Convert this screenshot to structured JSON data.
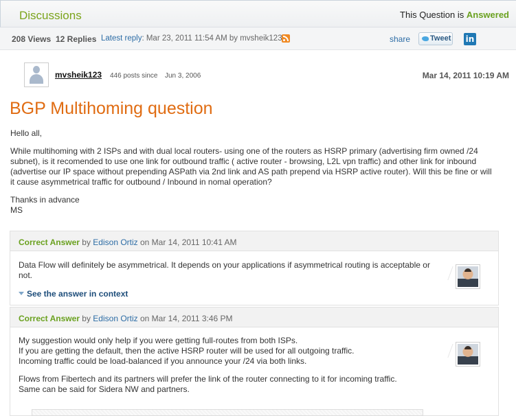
{
  "header": {
    "title": "Discussions",
    "status_prefix": "This Question is",
    "status_value": "Answered"
  },
  "metabar": {
    "views": "208 Views",
    "replies": "12 Replies",
    "latest_label": "Latest reply",
    "latest_info": ": Mar 23, 2011 11:54 AM by mvsheik123",
    "share": "share",
    "tweet": "Tweet",
    "linkedin": "in",
    "icons": [
      "rss-icon",
      "twitter-bird-icon",
      "linkedin-icon"
    ]
  },
  "post": {
    "author": "mvsheik123",
    "posts": "446 posts since",
    "since": "Jun 3, 2006",
    "date": "Mar 14, 2011 10:19 AM",
    "title": "BGP Multihoming question",
    "greeting": "Hello all,",
    "body": "While multihoming with 2 ISPs and with dual local routers- using one of the routers as HSRP primary (advertising firm owned /24 subnet), is it recomended to use one link for outbound traffic ( active router - browsing, L2L vpn traffic) and other link for inbound (advertise our IP space without prepending ASPath via 2nd link and AS path prepend via HSRP active router). Will this be fine or will it cause asymmetrical traffic for outbound / Inbound in nomal operation?",
    "thanks": "Thanks in advance",
    "signature": "MS"
  },
  "answers": [
    {
      "label": "Correct Answer",
      "by": "by",
      "author": "Edison Ortiz",
      "date": "on Mar 14, 2011 10:41 AM",
      "text1": "Data Flow will definitely be asymmetrical. It depends on your applications if asymmetrical routing is acceptable or not.",
      "link": "See the answer in context"
    },
    {
      "label": "Correct Answer",
      "by": "by",
      "author": "Edison Ortiz",
      "date": "on Mar 14, 2011 3:46 PM",
      "text1": "My suggestion would only help if you were getting full-routes from both ISPs.",
      "text2": "If you are getting the default, then the active HSRP router will be used for all outgoing traffic.",
      "text3": "Incoming traffic could be load-balanced if you announce your /24 via both links.",
      "text4": "Flows from Fibertech and its partners will prefer the link of the router connecting to it for incoming traffic.",
      "text5": "Same can be said for Sidera NW and partners."
    }
  ]
}
